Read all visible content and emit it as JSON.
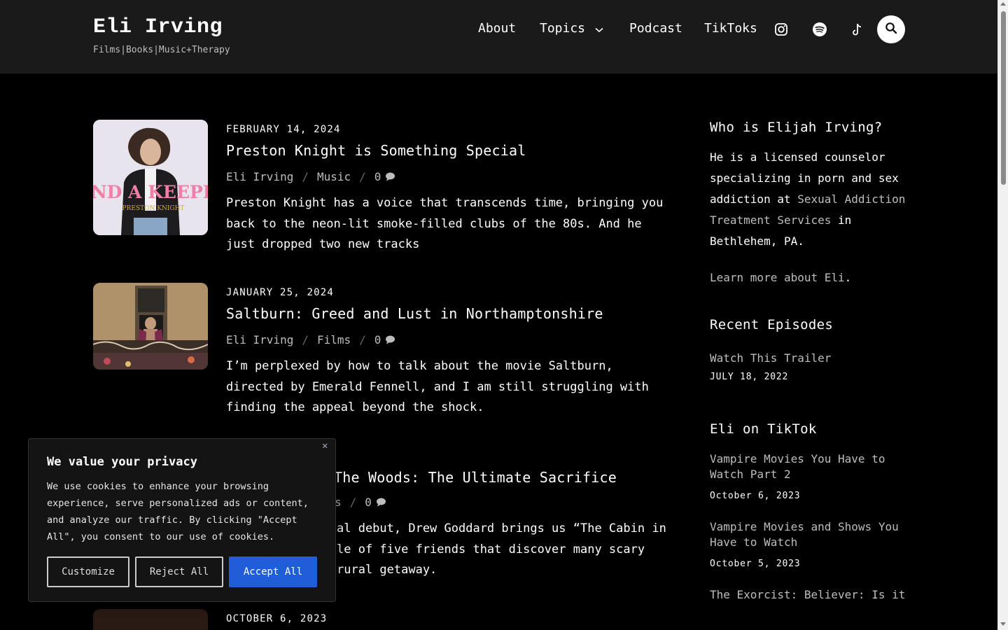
{
  "site": {
    "title": "Eli Irving",
    "tagline": "Films|Books|Music+Therapy"
  },
  "nav": {
    "about": "About",
    "topics": "Topics",
    "podcast": "Podcast",
    "tiktoks": "TikToks",
    "icons": [
      "instagram-icon",
      "spotify-icon",
      "tiktok-icon",
      "search-icon"
    ]
  },
  "posts": [
    {
      "date": "FEBRUARY 14, 2024",
      "title": "Preston Knight is Something Special",
      "author": "Eli Irving",
      "category": "Music",
      "comments": "0",
      "excerpt": "Preston Knight has a voice that transcends time, bringing you back to the neon-lit smoke-filled clubs of the 80s. And he just dropped two new tracks",
      "thumb_text_1": "FIND A KEEPER",
      "thumb_text_2": "PRESTON KNIGHT"
    },
    {
      "date": "JANUARY 25, 2024",
      "title": "Saltburn: Greed and Lust in Northamptonshire",
      "author": "Eli Irving",
      "category": "Films",
      "comments": "0",
      "excerpt": "I’m perplexed by how to talk about the movie Saltburn, directed by Emerald Fennell, and I am still struggling with finding the appeal beyond the shock."
    },
    {
      "title_visible": "The Woods: The Ultimate Sacrifice",
      "category_visible": "s",
      "comments": "0",
      "excerpt_line1": "al debut, Drew Goddard brings us “The Cabin in",
      "excerpt_line2": "le of five friends that discover many scary",
      "excerpt_line3": "rural getaway."
    },
    {
      "date": "OCTOBER 6, 2023"
    }
  ],
  "sidebar": {
    "who_heading": "Who is Elijah Irving?",
    "who_text_1": "He is a licensed counselor specializing in porn and sex addiction at ",
    "who_link": "Sexual Addiction Treatment Services",
    "who_text_2": " in Bethlehem, PA.",
    "learn_link": "Learn more about Eli",
    "learn_period": ".",
    "recent_heading": "Recent Episodes",
    "recent": [
      {
        "title": "Watch This Trailer",
        "date": "JULY 18, 2022"
      }
    ],
    "tiktok_heading": "Eli on TikTok",
    "tiktoks": [
      {
        "title": "Vampire Movies You Have to Watch Part 2",
        "date": "October 6, 2023"
      },
      {
        "title": "Vampire Movies and Shows You Have to Watch",
        "date": "October 5, 2023"
      },
      {
        "title": "The Exorcist: Believer: Is it"
      }
    ]
  },
  "cookie": {
    "title": "We value your privacy",
    "text": "We use cookies to enhance your browsing experience, serve personalized ads or content, and analyze our traffic. By clicking \"Accept All\", you consent to our use of cookies.",
    "customize": "Customize",
    "reject": "Reject All",
    "accept": "Accept All",
    "close": "✕"
  },
  "colors": {
    "background": "#000000",
    "header": "#1a1a1a",
    "link": "#bdbdbd",
    "accept_button": "#1f5ed8"
  }
}
